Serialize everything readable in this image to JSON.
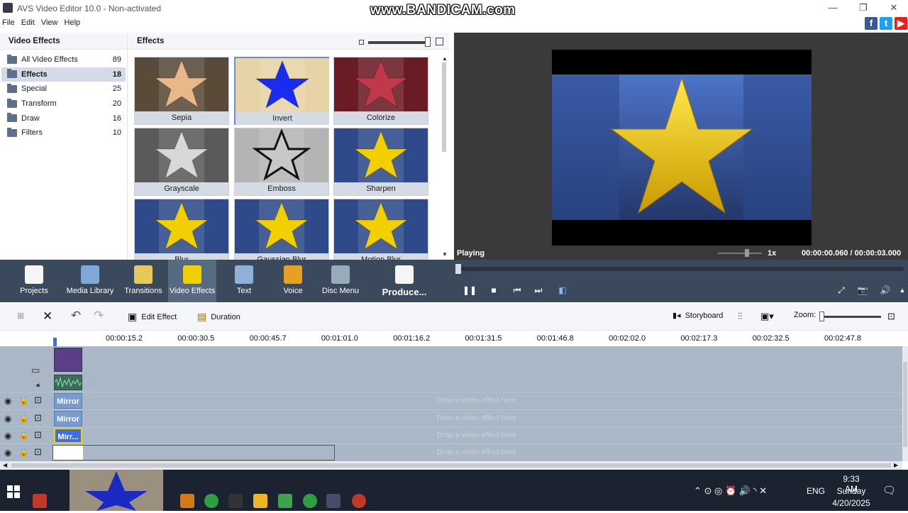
{
  "window": {
    "title": "AVS Video Editor 10.0 - Non-activated",
    "watermark": "www.BANDICAM.com"
  },
  "menu": [
    "File",
    "Edit",
    "View",
    "Help"
  ],
  "left_panel": {
    "title": "Video Effects",
    "items": [
      {
        "label": "All Video Effects",
        "count": "89"
      },
      {
        "label": "Effects",
        "count": "18",
        "selected": true
      },
      {
        "label": "Special",
        "count": "25"
      },
      {
        "label": "Transform",
        "count": "20"
      },
      {
        "label": "Draw",
        "count": "16"
      },
      {
        "label": "Filters",
        "count": "10"
      }
    ]
  },
  "effects_panel": {
    "title": "Effects",
    "thumbnails": [
      {
        "label": "Sepia",
        "star": "#e8b888",
        "bg": "#5a4a38"
      },
      {
        "label": "Invert",
        "star": "#1a2cf0",
        "bg": "#e6d3a6",
        "selected": true
      },
      {
        "label": "Colorize",
        "star": "#c0384a",
        "bg": "#6a1c24"
      },
      {
        "label": "Grayscale",
        "star": "#d8d8d8",
        "bg": "#5a5a5a"
      },
      {
        "label": "Emboss",
        "star": "#9a9a9a",
        "bg": "#b4b4b4"
      },
      {
        "label": "Sharpen",
        "star": "#f2d000",
        "bg": "#2e4a8a"
      },
      {
        "label": "Blur",
        "star": "#f2d000",
        "bg": "#2e4a8a"
      },
      {
        "label": "Gaussian Blur",
        "star": "#f2d000",
        "bg": "#2e4a8a"
      },
      {
        "label": "Motion Blur",
        "star": "#f2d000",
        "bg": "#2e4a8a"
      }
    ]
  },
  "preview": {
    "status": "Playing",
    "speed": "1x",
    "current_time": "00:00:00.060",
    "separator": "/",
    "total_time": "00:00:03.000"
  },
  "toolbar": [
    {
      "label": "Projects",
      "icon": "clapperboard-icon"
    },
    {
      "label": "Media Library",
      "icon": "film-icon"
    },
    {
      "label": "Transitions",
      "icon": "transitions-icon"
    },
    {
      "label": "Video Effects",
      "icon": "star-icon",
      "selected": true
    },
    {
      "label": "Text",
      "icon": "text-icon"
    },
    {
      "label": "Voice",
      "icon": "microphone-icon"
    },
    {
      "label": "Disc Menu",
      "icon": "disc-icon"
    },
    {
      "label": "Produce...",
      "icon": "produce-icon"
    }
  ],
  "timeline_toolbar": {
    "edit_effect": "Edit Effect",
    "duration": "Duration",
    "storyboard": "Storyboard",
    "zoom": "Zoom:"
  },
  "ruler": [
    "00:00:15.2",
    "00:00:30.5",
    "00:00:45.7",
    "00:01:01.0",
    "00:01:16.2",
    "00:01:31.5",
    "00:01:46.8",
    "00:02:02.0",
    "00:02:17.3",
    "00:02:32.5",
    "00:02:47.8"
  ],
  "tracks": {
    "clips": [
      "Mirror",
      "Mirror",
      "Mirr..."
    ],
    "drop_text": "Drop a video effect here"
  },
  "taskbar": {
    "time": "9:33 AM",
    "day": "Sunday",
    "date": "4/20/2025",
    "lang": "ENG"
  },
  "colors": {
    "toolbar_bg": "#3a4a5c",
    "accent_selection": "#d3dbe8",
    "track_bg": "#a9b7c6",
    "star_yellow": "#f2d000"
  }
}
